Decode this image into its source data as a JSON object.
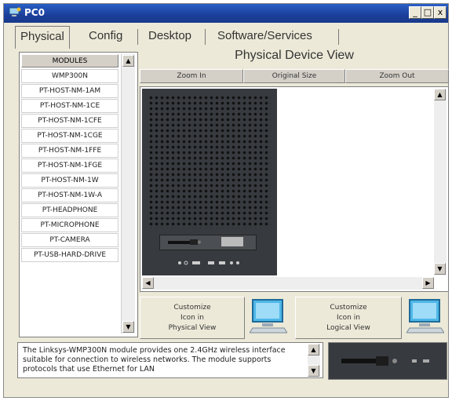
{
  "window": {
    "title": "PC0",
    "buttons": [
      "_",
      "□",
      "x"
    ]
  },
  "tabs": [
    {
      "label": "Physical",
      "active": true
    },
    {
      "label": "Config",
      "active": false
    },
    {
      "label": "Desktop",
      "active": false
    },
    {
      "label": "Software/Services",
      "active": false
    }
  ],
  "modules": {
    "header": "MODULES",
    "items": [
      "WMP300N",
      "PT-HOST-NM-1AM",
      "PT-HOST-NM-1CE",
      "PT-HOST-NM-1CFE",
      "PT-HOST-NM-1CGE",
      "PT-HOST-NM-1FFE",
      "PT-HOST-NM-1FGE",
      "PT-HOST-NM-1W",
      "PT-HOST-NM-1W-A",
      "PT-HEADPHONE",
      "PT-MICROPHONE",
      "PT-CAMERA",
      "PT-USB-HARD-DRIVE"
    ]
  },
  "physical_view": {
    "title": "Physical Device View",
    "zoom_in": "Zoom In",
    "original_size": "Original Size",
    "zoom_out": "Zoom Out"
  },
  "customize": {
    "physical": [
      "Customize",
      "Icon in",
      "Physical View"
    ],
    "logical": [
      "Customize",
      "Icon in",
      "Logical View"
    ]
  },
  "description": "The Linksys-WMP300N module provides one 2.4GHz wireless interface suitable for connection to wireless networks. The module supports protocols that use Ethernet for LAN",
  "colors": {
    "titlebar": "#1b3f9a",
    "window_bg": "#ece9d8",
    "device": "#373a3e"
  }
}
